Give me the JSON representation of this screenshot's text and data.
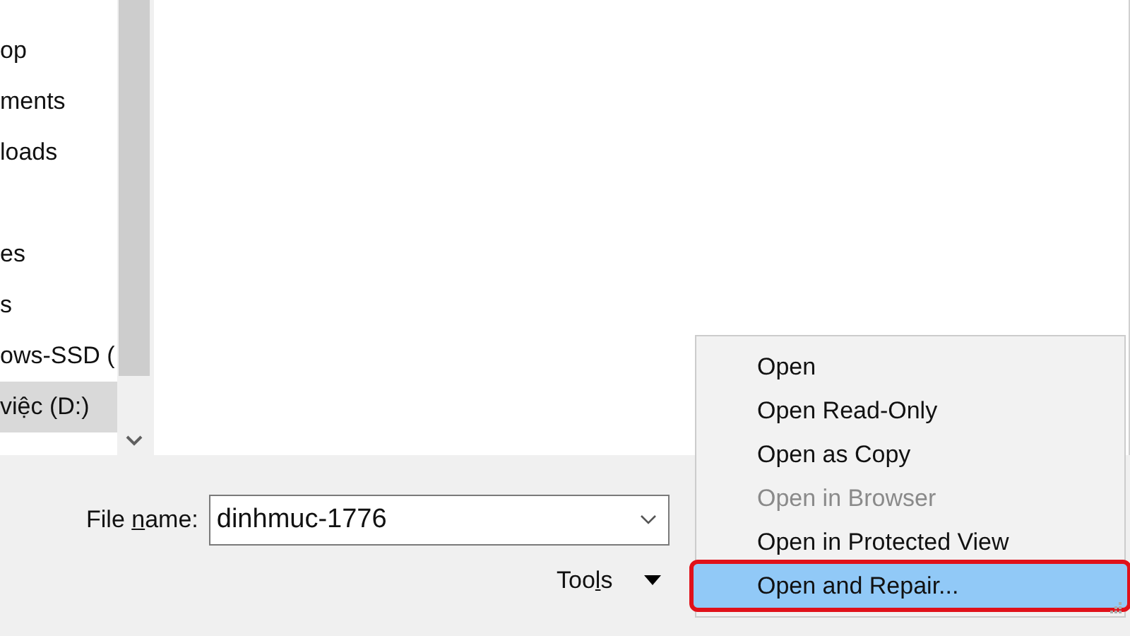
{
  "navigation_pane": {
    "items": [
      {
        "kind": "folder",
        "label": "op",
        "selected": false
      },
      {
        "kind": "folder",
        "label": "ments",
        "selected": false
      },
      {
        "kind": "folder",
        "label": "loads",
        "selected": false
      },
      {
        "kind": "spacer"
      },
      {
        "kind": "folder",
        "label": "es",
        "selected": false
      },
      {
        "kind": "folder",
        "label": "s",
        "selected": false
      },
      {
        "kind": "folder",
        "label": "ows-SSD (",
        "selected": false
      },
      {
        "kind": "folder",
        "label": "việc (D:)",
        "selected": true
      }
    ]
  },
  "file_name": {
    "label": {
      "before": "File ",
      "key": "n",
      "after": "ame:"
    },
    "value": "dinhmuc-1776"
  },
  "tools": {
    "label": {
      "before": "Too",
      "key": "l",
      "after": "s"
    }
  },
  "open_menu": {
    "items": [
      {
        "label": "Open",
        "selected": false,
        "disabled": false
      },
      {
        "label": "Open Read-Only",
        "selected": false,
        "disabled": false
      },
      {
        "label": "Open as Copy",
        "selected": false,
        "disabled": false
      },
      {
        "label": "Open in Browser",
        "selected": false,
        "disabled": true
      },
      {
        "label": "Open in Protected View",
        "selected": false,
        "disabled": false
      },
      {
        "label": "Open and Repair...",
        "selected": true,
        "disabled": false
      }
    ]
  }
}
